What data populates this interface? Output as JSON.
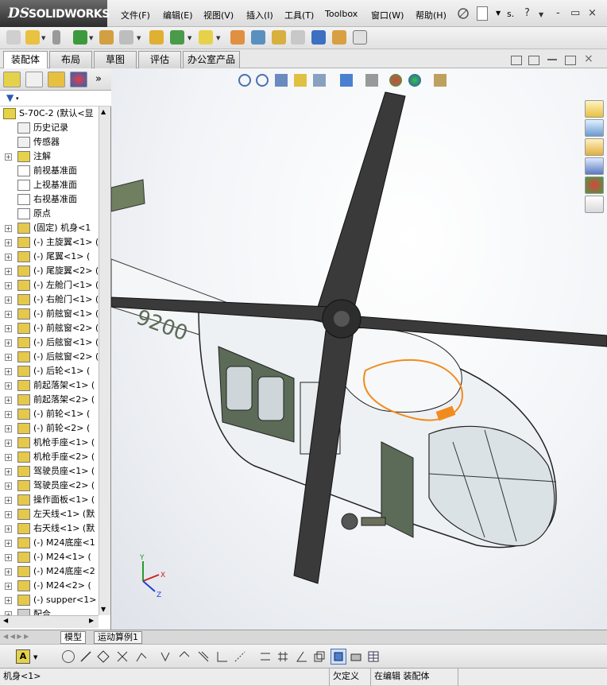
{
  "app": {
    "brand": "SOLIDWORKS",
    "logo_ds": "DS"
  },
  "menu": [
    "文件(F)",
    "编辑(E)",
    "视图(V)",
    "插入(I)",
    "工具(T)",
    "Toolbox",
    "窗口(W)",
    "帮助(H)"
  ],
  "title_short": "s.",
  "window_controls": [
    "?",
    "-",
    "▭",
    "×"
  ],
  "command_tabs": [
    "装配体",
    "布局",
    "草图",
    "评估",
    "办公室产品"
  ],
  "active_tab": "装配体",
  "feature_tree": {
    "root": "S-70C-2  (默认<显",
    "items": [
      {
        "label": "历史记录",
        "icon": "history-icon"
      },
      {
        "label": "传感器",
        "icon": "sensor-icon"
      },
      {
        "label": "注解",
        "icon": "annotation-icon",
        "expand": true
      },
      {
        "label": "前视基准面",
        "icon": "plane-icon"
      },
      {
        "label": "上视基准面",
        "icon": "plane-icon"
      },
      {
        "label": "右视基准面",
        "icon": "plane-icon"
      },
      {
        "label": "原点",
        "icon": "origin-icon"
      },
      {
        "label": "(固定) 机身<1",
        "icon": "part-icon",
        "expand": true
      },
      {
        "label": "(-) 主旋翼<1> (",
        "icon": "part-icon",
        "expand": true
      },
      {
        "label": "(-) 尾翼<1> (",
        "icon": "part-icon",
        "expand": true
      },
      {
        "label": "(-) 尾旋翼<2> (",
        "icon": "part-icon",
        "expand": true
      },
      {
        "label": "(-) 左舱门<1> (",
        "icon": "part-icon",
        "expand": true
      },
      {
        "label": "(-) 右舱门<1> (",
        "icon": "part-icon",
        "expand": true
      },
      {
        "label": "(-) 前舷窗<1> (",
        "icon": "part-icon",
        "expand": true
      },
      {
        "label": "(-) 前舷窗<2> (",
        "icon": "part-icon",
        "expand": true
      },
      {
        "label": "(-) 后舷窗<1> (",
        "icon": "part-icon",
        "expand": true
      },
      {
        "label": "(-) 后舷窗<2> (",
        "icon": "part-icon",
        "expand": true
      },
      {
        "label": "(-) 后轮<1> (",
        "icon": "part-icon",
        "expand": true
      },
      {
        "label": "前起落架<1> (",
        "icon": "part-icon",
        "expand": true
      },
      {
        "label": "前起落架<2> (",
        "icon": "part-icon",
        "expand": true
      },
      {
        "label": "(-) 前轮<1> (",
        "icon": "part-icon",
        "expand": true
      },
      {
        "label": "(-) 前轮<2> (",
        "icon": "part-icon",
        "expand": true
      },
      {
        "label": "机枪手座<1> (",
        "icon": "part-icon",
        "expand": true
      },
      {
        "label": "机枪手座<2> (",
        "icon": "part-icon",
        "expand": true
      },
      {
        "label": "驾驶员座<1> (",
        "icon": "part-icon",
        "expand": true
      },
      {
        "label": "驾驶员座<2> (",
        "icon": "part-icon",
        "expand": true
      },
      {
        "label": "操作面板<1> (",
        "icon": "part-icon",
        "expand": true
      },
      {
        "label": "左天线<1> (默",
        "icon": "part-icon",
        "expand": true
      },
      {
        "label": "右天线<1> (默",
        "icon": "part-icon",
        "expand": true
      },
      {
        "label": "(-) M24底座<1",
        "icon": "part-icon",
        "expand": true
      },
      {
        "label": "(-) M24<1> (",
        "icon": "part-icon",
        "expand": true
      },
      {
        "label": "(-) M24底座<2",
        "icon": "part-icon",
        "expand": true
      },
      {
        "label": "(-) M24<2> (",
        "icon": "part-icon",
        "expand": true
      },
      {
        "label": "(-) supper<1>",
        "icon": "part-icon",
        "expand": true
      },
      {
        "label": "配合",
        "icon": "mates-icon",
        "expand": true
      }
    ]
  },
  "bottom_tabs": [
    "模型",
    "运动算例1"
  ],
  "status": {
    "selection": "机身<1>",
    "definition": "欠定义",
    "editing": "在编辑 装配体"
  },
  "model": {
    "tail_number": "9200",
    "body_color": "#f2f4f6",
    "accent_color": "#5b6b57",
    "rotor_color": "#3a3a3a",
    "highlight_color": "#f08c1e"
  },
  "triad": {
    "x": "X",
    "y": "Y",
    "z": "Z"
  }
}
